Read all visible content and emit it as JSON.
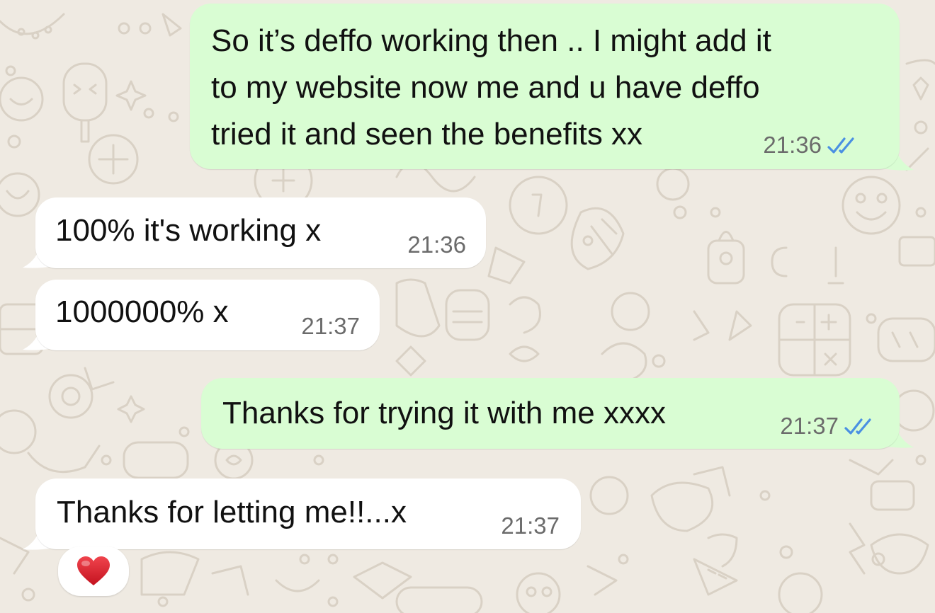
{
  "chat": {
    "accent_incoming_bg": "#ffffff",
    "accent_outgoing_bg": "#d9fdd3",
    "read_tick_color": "#4a90e2",
    "messages": [
      {
        "direction": "outgoing",
        "lines": [
          "So it’s deffo working then .. I might add it",
          "to my website now me and u have deffo",
          "tried it and seen the benefits xx"
        ],
        "time": "21:36",
        "status": "read"
      },
      {
        "direction": "incoming",
        "text": "100% it's working x",
        "time": "21:36"
      },
      {
        "direction": "incoming",
        "text": "1000000% x",
        "time": "21:37"
      },
      {
        "direction": "outgoing",
        "text": "Thanks for trying it with me xxxx",
        "time": "21:37",
        "status": "read"
      },
      {
        "direction": "incoming",
        "text": "Thanks for letting me!!...x",
        "time": "21:37",
        "reaction": "heart-emoji"
      }
    ]
  }
}
